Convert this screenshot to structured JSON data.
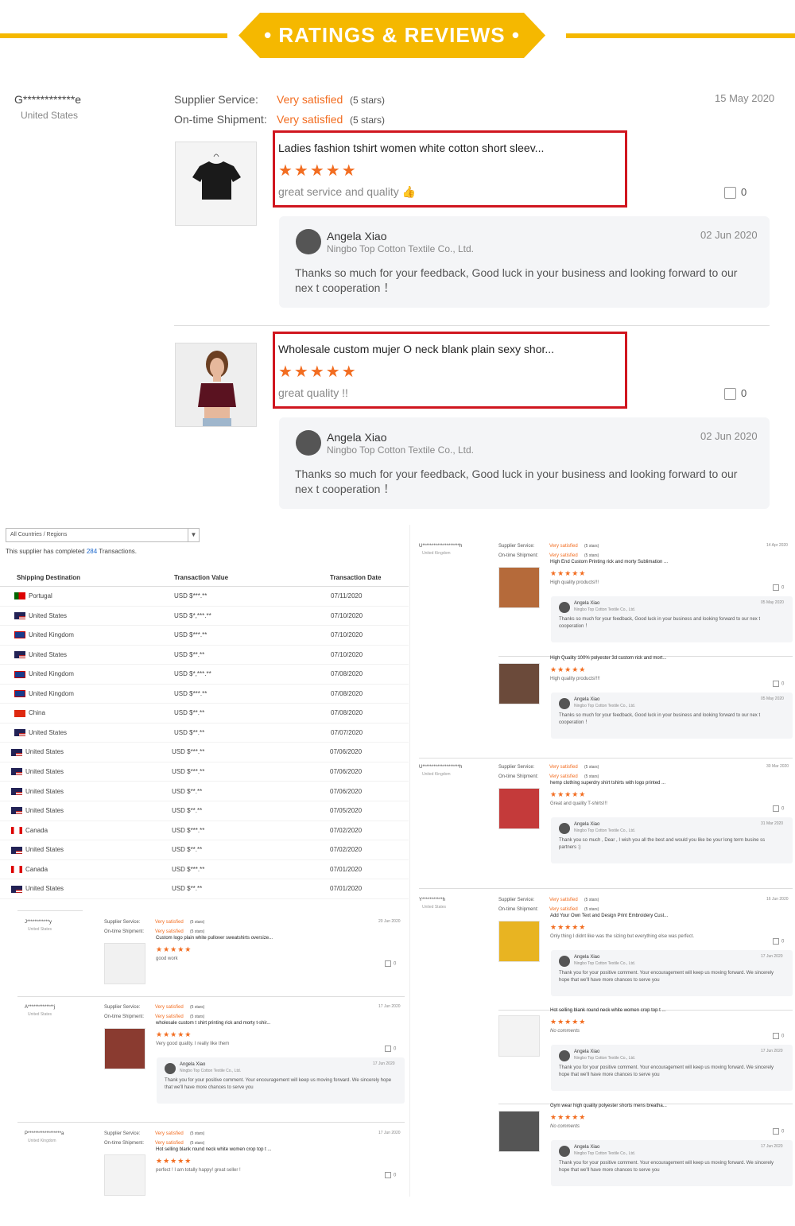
{
  "banner": {
    "title": "• RATINGS & REVIEWS •"
  },
  "main_reviews": {
    "reviewer": "G************e",
    "country": "United States",
    "date": "15 May 2020",
    "supplier_label": "Supplier Service:",
    "shipment_label": "On-time Shipment:",
    "rating_text": "Very satisfied",
    "rating_count": "(5 stars)",
    "items": [
      {
        "title": "Ladies fashion tshirt women white cotton short sleev...",
        "stars": "★★★★★",
        "comment": "great service and quality 👍",
        "likes": "0",
        "reply": {
          "name": "Angela Xiao",
          "company": "Ningbo Top Cotton Textile Co., Ltd.",
          "date": "02 Jun 2020",
          "text": "Thanks so much for your feedback, Good luck in your business and looking forward to our nex t cooperation ！"
        }
      },
      {
        "title": "Wholesale custom mujer O neck blank plain sexy shor...",
        "stars": "★★★★★",
        "comment": "great quality !!",
        "likes": "0",
        "reply": {
          "name": "Angela Xiao",
          "company": "Ningbo Top Cotton Textile Co., Ltd.",
          "date": "02 Jun 2020",
          "text": "Thanks so much for your feedback, Good luck in your business and looking forward to our nex t cooperation ！"
        }
      }
    ]
  },
  "transactions": {
    "filter": "All Countries / Regions",
    "summary_pre": "This supplier has completed ",
    "summary_count": "284",
    "summary_post": " Transactions.",
    "headers": [
      "Shipping Destination",
      "Transaction Value",
      "Transaction Date"
    ],
    "rows": [
      {
        "country": "Portugal",
        "flag": "pt",
        "value": "USD $***.**",
        "date": "07/11/2020"
      },
      {
        "country": "United States",
        "flag": "us",
        "value": "USD $*,***.**",
        "date": "07/10/2020"
      },
      {
        "country": "United Kingdom",
        "flag": "uk",
        "value": "USD $***.**",
        "date": "07/10/2020"
      },
      {
        "country": "United States",
        "flag": "us",
        "value": "USD $**.**",
        "date": "07/10/2020"
      },
      {
        "country": "United Kingdom",
        "flag": "uk",
        "value": "USD $*,***.**",
        "date": "07/08/2020"
      },
      {
        "country": "United Kingdom",
        "flag": "uk",
        "value": "USD $***.**",
        "date": "07/08/2020"
      },
      {
        "country": "China",
        "flag": "cn",
        "value": "USD $**.**",
        "date": "07/08/2020"
      },
      {
        "country": "United States",
        "flag": "us",
        "value": "USD $**.**",
        "date": "07/07/2020"
      },
      {
        "country": "United States",
        "flag": "us",
        "value": "USD $***.**",
        "date": "07/06/2020"
      },
      {
        "country": "United States",
        "flag": "us",
        "value": "USD $***.**",
        "date": "07/06/2020"
      },
      {
        "country": "United States",
        "flag": "us",
        "value": "USD $**.**",
        "date": "07/06/2020"
      },
      {
        "country": "United States",
        "flag": "us",
        "value": "USD $**.**",
        "date": "07/05/2020"
      },
      {
        "country": "Canada",
        "flag": "ca",
        "value": "USD $***.**",
        "date": "07/02/2020"
      },
      {
        "country": "United States",
        "flag": "us",
        "value": "USD $**.**",
        "date": "07/02/2020"
      },
      {
        "country": "Canada",
        "flag": "ca",
        "value": "USD $***.**",
        "date": "07/01/2020"
      },
      {
        "country": "United States",
        "flag": "us",
        "value": "USD $**.**",
        "date": "07/01/2020"
      }
    ]
  },
  "right_reviews": [
    {
      "reviewer": "U********************h",
      "country": "United Kingdom",
      "date": "14 Apr 2020",
      "items": [
        {
          "title": "High End Custom Printing rick and morty Sublimation ...",
          "comment": "High quality products!!!",
          "likes": "0",
          "reply": {
            "name": "Angela Xiao",
            "company": "Ningbo Top Cotton Textile Co., Ltd.",
            "date": "05 May 2020",
            "text": "Thanks so much for your feedback, Good luck in your business and looking forward to our nex t cooperation ！"
          }
        },
        {
          "title": "High Quality 100% polyester 3d custom rick and mort...",
          "comment": "High quality products!!!!",
          "likes": "0",
          "reply": {
            "name": "Angela Xiao",
            "company": "Ningbo Top Cotton Textile Co., Ltd.",
            "date": "05 May 2020",
            "text": "Thanks so much for your feedback, Good luck in your business and looking forward to our nex t cooperation ！"
          }
        }
      ]
    },
    {
      "reviewer": "U********************h",
      "country": "United Kingdom",
      "date": "30 Mar 2020",
      "items": [
        {
          "title": "hemp clothing superdry shirt tshirts with logo printed ...",
          "comment": "Great and quality T-shirts!!!",
          "likes": "0",
          "reply": {
            "name": "Angela Xiao",
            "company": "Ningbo Top Cotton Textile Co., Ltd.",
            "date": "31 Mar 2020",
            "text": "Thank you so much , Dear , I wish you all the best and would you like be your long term busine ss partners :)"
          }
        }
      ]
    },
    {
      "reviewer": "Y***********h",
      "country": "United States",
      "date": "16 Jun 2020",
      "items": [
        {
          "title": "Add Your Own Text and Design Print Embroidery Cust...",
          "comment": "Only thing I didnt like was the sizing but everything else was perfect.",
          "likes": "0",
          "reply": {
            "name": "Angela Xiao",
            "company": "Ningbo Top Cotton Textile Co., Ltd.",
            "date": "17 Jun 2020",
            "text": "Thank you for your positive comment. Your encouragement will keep us moving forward. We sincerely hope that we'll have more chances to serve you"
          }
        },
        {
          "title": "Hot selling blank round neck white women crop top t ...",
          "comment": "No comments",
          "likes": "0",
          "reply": {
            "name": "Angela Xiao",
            "company": "Ningbo Top Cotton Textile Co., Ltd.",
            "date": "17 Jun 2020",
            "text": "Thank you for your positive comment. Your encouragement will keep us moving forward. We sincerely hope that we'll have more chances to serve you"
          }
        },
        {
          "title": "Gym wear high quality polyester shorts mens breatha...",
          "comment": "No comments",
          "likes": "0",
          "reply": {
            "name": "Angela Xiao",
            "company": "Ningbo Top Cotton Textile Co., Ltd.",
            "date": "17 Jun 2020",
            "text": "Thank you for your positive comment. Your encouragement will keep us moving forward. We sincerely hope that we'll have more chances to serve you"
          }
        }
      ]
    }
  ],
  "bottom_left_reviews": [
    {
      "reviewer": "J************y",
      "country": "United States",
      "date": "20 Jun 2020",
      "title": "Custom logo plain white pullover sweatshirts oversize...",
      "comment": "good work",
      "likes": "0"
    },
    {
      "reviewer": "A**************j",
      "country": "United States",
      "date": "17 Jun 2020",
      "title": "wholesale custom t shirt printing rick and morty t-shir...",
      "comment": "Very good quality. I really like them",
      "likes": "0",
      "reply": {
        "name": "Angela Xiao",
        "company": "Ningbo Top Cotton Textile Co., Ltd.",
        "date": "17 Jun 2020",
        "text": "Thank you for your positive comment. Your encouragement will keep us moving forward. We sincerely hope that we'll have more chances to serve you"
      }
    },
    {
      "reviewer": "P******************a",
      "country": "United Kingdom",
      "date": "17 Jun 2020",
      "title": "Hot selling blank round neck white women crop top t ...",
      "comment": "perfect ! I am totally happy! great seller !",
      "likes": "0"
    }
  ]
}
